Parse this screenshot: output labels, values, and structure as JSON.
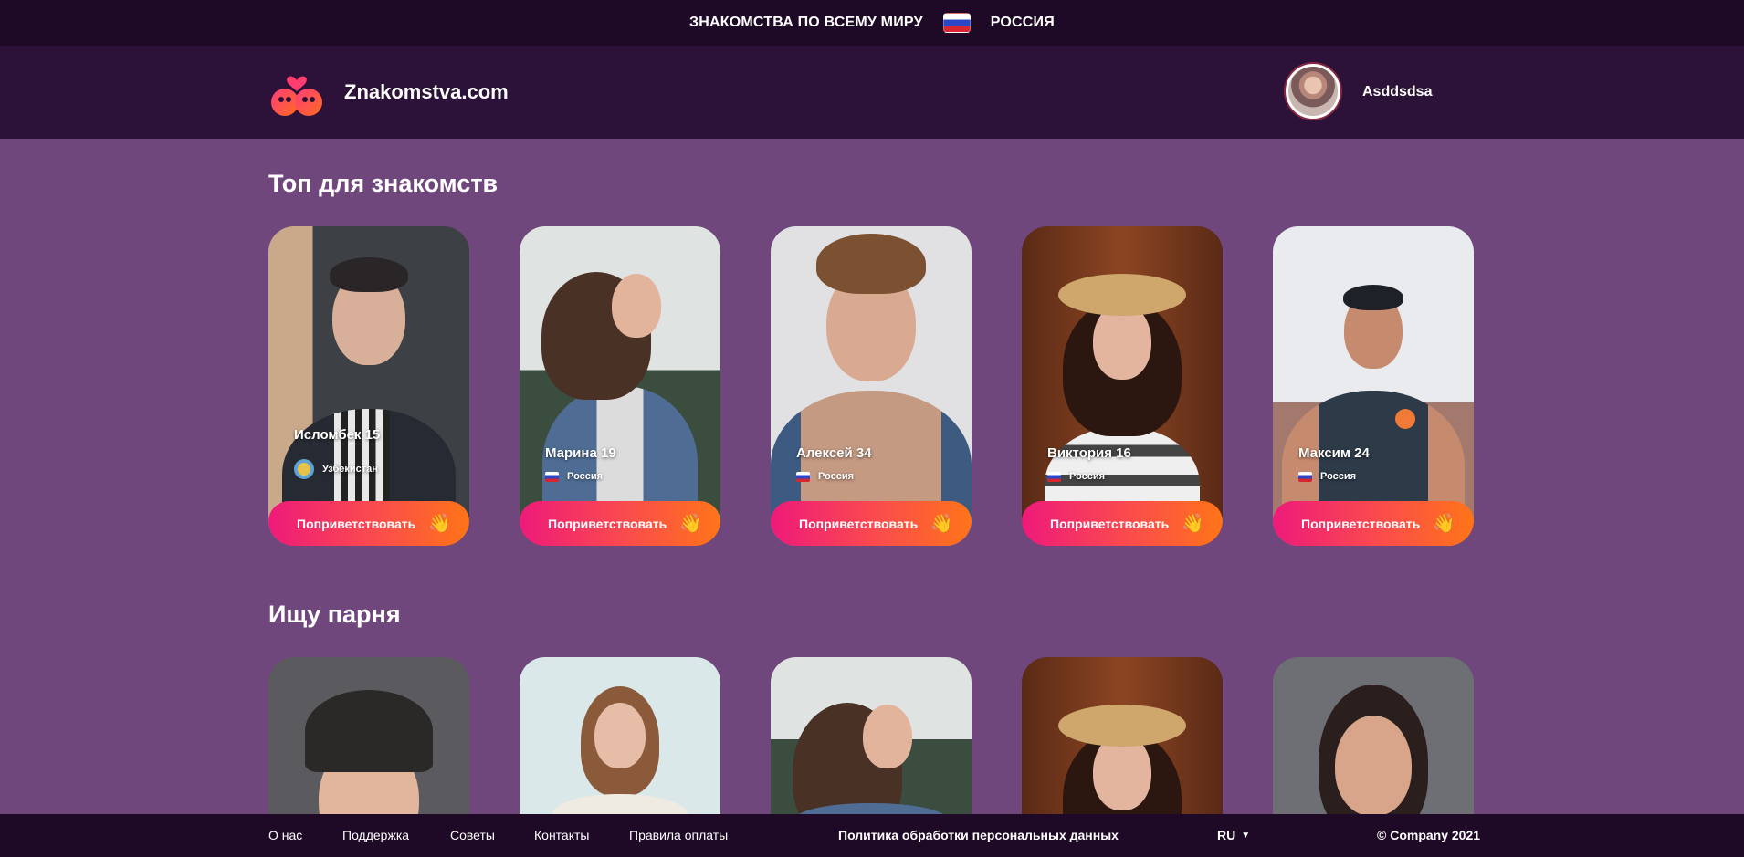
{
  "topbar": {
    "tagline": "ЗНАКОМСТВА ПО ВСЕМУ МИРУ",
    "country": "РОССИЯ",
    "flag_icon": "russia-flag-icon"
  },
  "header": {
    "brand": "Znakomstva.com",
    "logo_icon": "hearts-birds-logo-icon",
    "username": "Asddsdsa"
  },
  "sections": [
    {
      "title": "Топ для знакомств",
      "cards": [
        {
          "name": "Исломбек 15",
          "country": "Узбекистан",
          "button": "Поприветствовать",
          "wave_icon": "👋"
        },
        {
          "name": "Марина 19",
          "country": "Россия",
          "button": "Поприветствовать",
          "wave_icon": "👋"
        },
        {
          "name": "Алексей 34",
          "country": "Россия",
          "button": "Поприветствовать",
          "wave_icon": "👋"
        },
        {
          "name": "Виктория 16",
          "country": "Россия",
          "button": "Поприветствовать",
          "wave_icon": "👋"
        },
        {
          "name": "Максим 24",
          "country": "Россия",
          "button": "Поприветствовать",
          "wave_icon": "👋"
        }
      ]
    },
    {
      "title": "Ищу парня"
    }
  ],
  "footer": {
    "links": [
      "О нас",
      "Поддержка",
      "Советы",
      "Контакты",
      "Правила оплаты"
    ],
    "privacy": "Политика обработки персональных данных",
    "language": "RU",
    "copyright": "© Company 2021"
  },
  "colors": {
    "page_bg": "#6f477c",
    "header_bg": "#2c1238",
    "topbar_bg": "#1e0a26",
    "button_from": "#ee1a7a",
    "button_to": "#ff7418"
  }
}
